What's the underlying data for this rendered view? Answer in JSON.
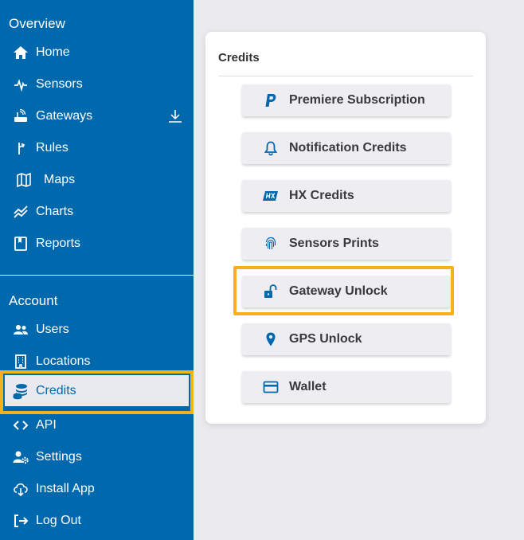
{
  "sidebar": {
    "overview_title": "Overview",
    "account_title": "Account",
    "overview_items": [
      {
        "label": "Home",
        "icon": "home-icon"
      },
      {
        "label": "Sensors",
        "icon": "sensor-pulse-icon"
      },
      {
        "label": "Gateways",
        "icon": "gateway-icon"
      },
      {
        "label": "Rules",
        "icon": "rules-icon"
      },
      {
        "label": "Maps",
        "icon": "map-icon"
      },
      {
        "label": "Charts",
        "icon": "chart-icon"
      },
      {
        "label": "Reports",
        "icon": "report-icon"
      }
    ],
    "account_items": [
      {
        "label": "Users",
        "icon": "users-icon"
      },
      {
        "label": "Locations",
        "icon": "building-icon"
      },
      {
        "label": "Credits",
        "icon": "coins-icon",
        "active": true
      },
      {
        "label": "API",
        "icon": "code-icon"
      },
      {
        "label": "Settings",
        "icon": "user-gear-icon"
      },
      {
        "label": "Install App",
        "icon": "cloud-download-icon"
      },
      {
        "label": "Log Out",
        "icon": "logout-icon"
      }
    ]
  },
  "credits_panel": {
    "title": "Credits",
    "buttons": [
      {
        "label": "Premiere Subscription",
        "icon": "paypal-icon"
      },
      {
        "label": "Notification Credits",
        "icon": "bell-icon"
      },
      {
        "label": "HX Credits",
        "icon": "hx-icon"
      },
      {
        "label": "Sensors Prints",
        "icon": "fingerprint-icon"
      },
      {
        "label": "Gateway Unlock",
        "icon": "unlock-icon",
        "highlighted": true
      },
      {
        "label": "GPS Unlock",
        "icon": "map-pin-icon"
      },
      {
        "label": "Wallet",
        "icon": "wallet-icon"
      }
    ]
  },
  "colors": {
    "sidebar": "#0068ad",
    "highlight": "#f3b21a",
    "icon_blue": "#0068ad"
  }
}
